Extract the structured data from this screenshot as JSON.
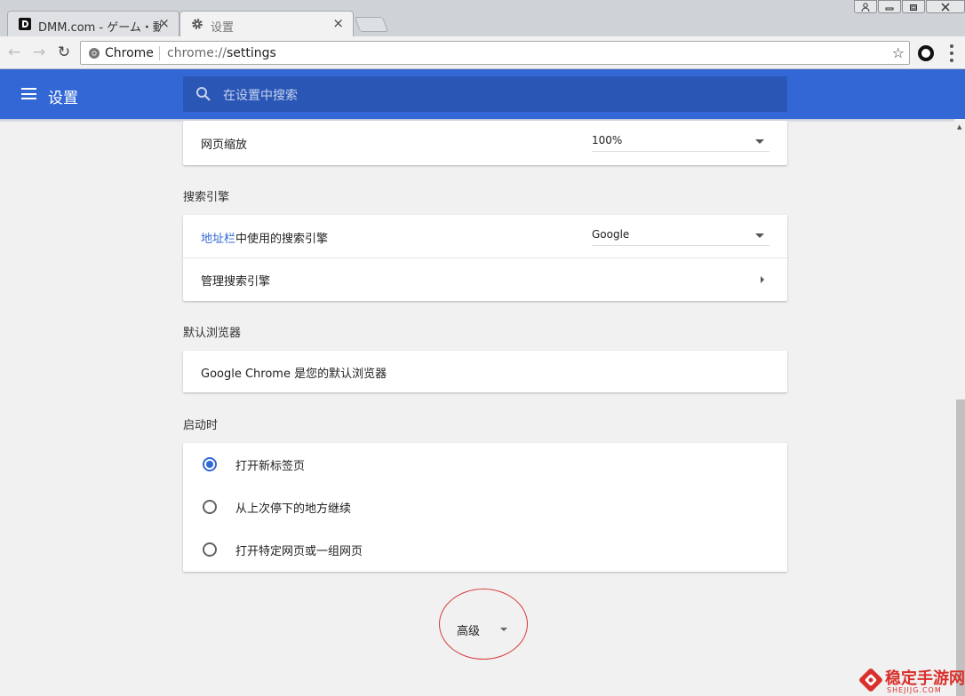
{
  "tabs": [
    {
      "title": "DMM.com - ゲーム・動",
      "close": "×",
      "active": false
    },
    {
      "title": "设置",
      "close": "×",
      "active": true
    }
  ],
  "window": {
    "min": "–",
    "restore": "❐",
    "close": "✕",
    "user": "👤"
  },
  "toolbar": {
    "back": "←",
    "forward": "→",
    "reload": "↻",
    "site_label": "Chrome",
    "url_scheme": "chrome://",
    "url_host": "settings",
    "star": "☆"
  },
  "header": {
    "title": "设置",
    "search_placeholder": "在设置中搜索"
  },
  "appearance": {
    "zoom_label": "网页缩放",
    "zoom_value": "100%"
  },
  "search_engine": {
    "section_title": "搜索引擎",
    "row1_link": "地址栏",
    "row1_rest": "中使用的搜索引擎",
    "row1_value": "Google",
    "row2_label": "管理搜索引擎"
  },
  "default_browser": {
    "section_title": "默认浏览器",
    "text": "Google Chrome 是您的默认浏览器"
  },
  "startup": {
    "section_title": "启动时",
    "options": [
      {
        "label": "打开新标签页",
        "selected": true
      },
      {
        "label": "从上次停下的地方继续",
        "selected": false
      },
      {
        "label": "打开特定网页或一组网页",
        "selected": false
      }
    ]
  },
  "advanced": {
    "label": "高级"
  },
  "watermark": {
    "cn": "稳定手游网",
    "en": "SHEJIJG.COM"
  },
  "colors": {
    "header_blue": "#3367d6",
    "search_blue": "#2a56b5",
    "highlight_red": "#d83b3b"
  }
}
